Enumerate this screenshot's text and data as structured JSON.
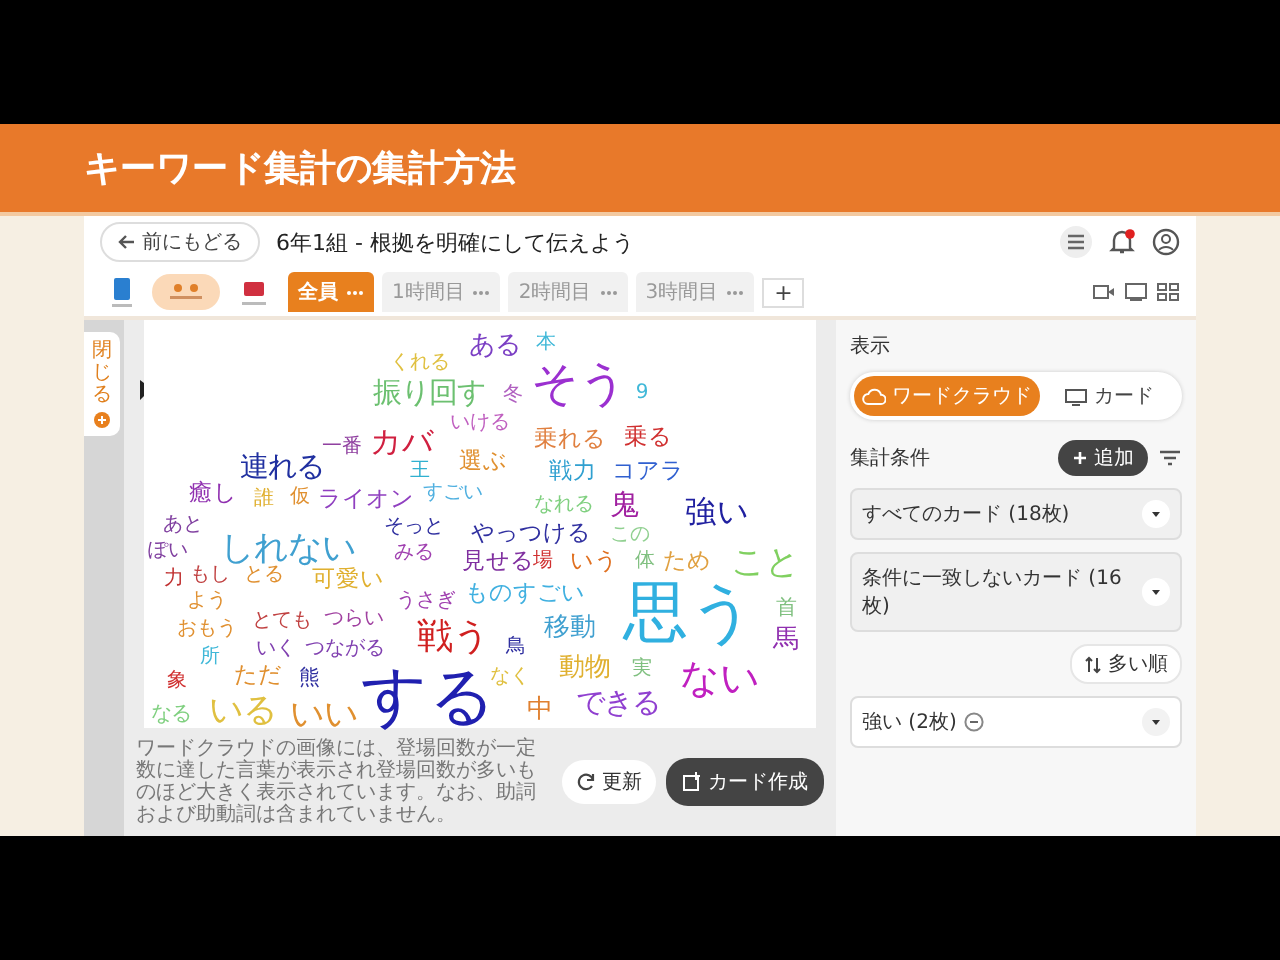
{
  "slide": {
    "title": "キーワード集計の集計方法"
  },
  "app": {
    "back_button": "前にもどる",
    "title": "6年1組 - 根拠を明確にして伝えよう",
    "tabs": [
      {
        "label": "全員",
        "selected": true
      },
      {
        "label": "1時間目",
        "selected": false
      },
      {
        "label": "2時間目",
        "selected": false
      },
      {
        "label": "3時間目",
        "selected": false
      }
    ],
    "add_tab": "+",
    "side_tab": "閉じる",
    "word_cloud": {
      "words": [
        {
          "text": "くれる",
          "color": "#e0c040"
        },
        {
          "text": "ある",
          "color": "#7b3fc4"
        },
        {
          "text": "本",
          "color": "#40b8d8"
        },
        {
          "text": "振り回す",
          "color": "#6cc070"
        },
        {
          "text": "冬",
          "color": "#b060c0"
        },
        {
          "text": "そう",
          "color": "#9b30d0"
        },
        {
          "text": "9",
          "color": "#40b8d8"
        },
        {
          "text": "一番",
          "color": "#9040a0"
        },
        {
          "text": "カバ",
          "color": "#d02040"
        },
        {
          "text": "いける",
          "color": "#c060c0"
        },
        {
          "text": "乗れる",
          "color": "#e08040"
        },
        {
          "text": "乗る",
          "color": "#d03030"
        },
        {
          "text": "連れる",
          "color": "#2030a0"
        },
        {
          "text": "王",
          "color": "#30b0d0"
        },
        {
          "text": "選ぶ",
          "color": "#e09030"
        },
        {
          "text": "戦力",
          "color": "#30a0d0"
        },
        {
          "text": "コアラ",
          "color": "#3060d0"
        },
        {
          "text": "癒し",
          "color": "#9030b0"
        },
        {
          "text": "誰",
          "color": "#e0b030"
        },
        {
          "text": "仮",
          "color": "#e09030"
        },
        {
          "text": "ライオン",
          "color": "#9040c0"
        },
        {
          "text": "すごい",
          "color": "#50b0e0"
        },
        {
          "text": "なれる",
          "color": "#80d080"
        },
        {
          "text": "鬼",
          "color": "#a020a0"
        },
        {
          "text": "強い",
          "color": "#2020a0"
        },
        {
          "text": "あと",
          "color": "#8040a0"
        },
        {
          "text": "そっと",
          "color": "#3030a0"
        },
        {
          "text": "やっつける",
          "color": "#3030a0"
        },
        {
          "text": "この",
          "color": "#90d090"
        },
        {
          "text": "ぽい",
          "color": "#8040a0"
        },
        {
          "text": "しれない",
          "color": "#40a0d0"
        },
        {
          "text": "みる",
          "color": "#a040b0"
        },
        {
          "text": "見せる",
          "color": "#8030a0"
        },
        {
          "text": "場",
          "color": "#d03030"
        },
        {
          "text": "いう",
          "color": "#e07020"
        },
        {
          "text": "体",
          "color": "#80c080"
        },
        {
          "text": "ため",
          "color": "#e0a040"
        },
        {
          "text": "こと",
          "color": "#80d060"
        },
        {
          "text": "力",
          "color": "#c03030"
        },
        {
          "text": "もし",
          "color": "#c04040"
        },
        {
          "text": "とる",
          "color": "#e09030"
        },
        {
          "text": "可愛い",
          "color": "#e0b030"
        },
        {
          "text": "よう",
          "color": "#e09030"
        },
        {
          "text": "うさぎ",
          "color": "#a040b0"
        },
        {
          "text": "ものすごい",
          "color": "#40b0e0"
        },
        {
          "text": "おもう",
          "color": "#e09030"
        },
        {
          "text": "とても",
          "color": "#c04040"
        },
        {
          "text": "つらい",
          "color": "#a040a0"
        },
        {
          "text": "戦う",
          "color": "#d02020"
        },
        {
          "text": "移動",
          "color": "#40a0d0"
        },
        {
          "text": "思う",
          "color": "#30b0e0"
        },
        {
          "text": "首",
          "color": "#80c080"
        },
        {
          "text": "馬",
          "color": "#9030b0"
        },
        {
          "text": "所",
          "color": "#40b8d8"
        },
        {
          "text": "いく",
          "color": "#8040b0"
        },
        {
          "text": "つながる",
          "color": "#8040b0"
        },
        {
          "text": "鳥",
          "color": "#3030a0"
        },
        {
          "text": "象",
          "color": "#d03030"
        },
        {
          "text": "ただ",
          "color": "#e09030"
        },
        {
          "text": "熊",
          "color": "#3030a0"
        },
        {
          "text": "動物",
          "color": "#e0b030"
        },
        {
          "text": "実",
          "color": "#80c080"
        },
        {
          "text": "ない",
          "color": "#c020c0"
        },
        {
          "text": "なる",
          "color": "#80d080"
        },
        {
          "text": "いる",
          "color": "#e0c040"
        },
        {
          "text": "いい",
          "color": "#e09030"
        },
        {
          "text": "する",
          "color": "#2020b0"
        },
        {
          "text": "なく",
          "color": "#e0c040"
        },
        {
          "text": "中",
          "color": "#e08030"
        },
        {
          "text": "できる",
          "color": "#9040d0"
        }
      ]
    },
    "note": "ワードクラウドの画像には、登場回数が一定数に達した言葉が表示され登場回数が多いものほど大きく表示されています。なお、助詞および助動詞は含まれていません。",
    "refresh_button": "更新",
    "create_button": "カード作成",
    "panel": {
      "display_label": "表示",
      "view_toggle": [
        {
          "label": "ワードクラウド",
          "kind": "cloud",
          "selected": true
        },
        {
          "label": "カード",
          "kind": "card",
          "selected": false
        }
      ],
      "conditions_label": "集計条件",
      "add_button": "追加",
      "filters": [
        {
          "label": "すべてのカード (18枚)"
        },
        {
          "label": "条件に一致しないカード (16枚)"
        }
      ],
      "sort_button": "多い順",
      "keyword_filter": {
        "label": "強い (2枚)"
      }
    }
  }
}
